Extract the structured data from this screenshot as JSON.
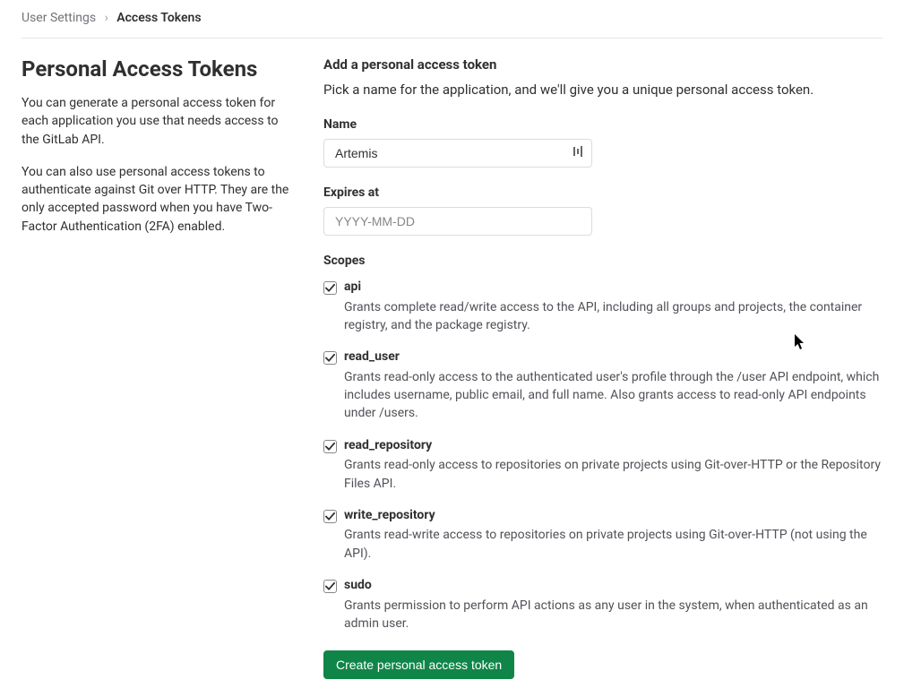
{
  "breadcrumb": {
    "parent": "User Settings",
    "current": "Access Tokens"
  },
  "sidebar": {
    "title": "Personal Access Tokens",
    "para1": "You can generate a personal access token for each application you use that needs access to the GitLab API.",
    "para2": "You can also use personal access tokens to authenticate against Git over HTTP. They are the only accepted password when you have Two-Factor Authentication (2FA) enabled."
  },
  "form": {
    "heading": "Add a personal access token",
    "intro": "Pick a name for the application, and we'll give you a unique personal access token.",
    "name_label": "Name",
    "name_value": "Artemis",
    "expires_label": "Expires at",
    "expires_placeholder": "YYYY-MM-DD",
    "expires_value": "",
    "scopes_label": "Scopes",
    "submit_label": "Create personal access token"
  },
  "scopes": [
    {
      "name": "api",
      "checked": true,
      "desc": "Grants complete read/write access to the API, including all groups and projects, the container registry, and the package registry."
    },
    {
      "name": "read_user",
      "checked": true,
      "desc": "Grants read-only access to the authenticated user's profile through the /user API endpoint, which includes username, public email, and full name. Also grants access to read-only API endpoints under /users."
    },
    {
      "name": "read_repository",
      "checked": true,
      "desc": "Grants read-only access to repositories on private projects using Git-over-HTTP or the Repository Files API."
    },
    {
      "name": "write_repository",
      "checked": true,
      "desc": "Grants read-write access to repositories on private projects using Git-over-HTTP (not using the API)."
    },
    {
      "name": "sudo",
      "checked": true,
      "desc": "Grants permission to perform API actions as any user in the system, when authenticated as an admin user."
    }
  ]
}
